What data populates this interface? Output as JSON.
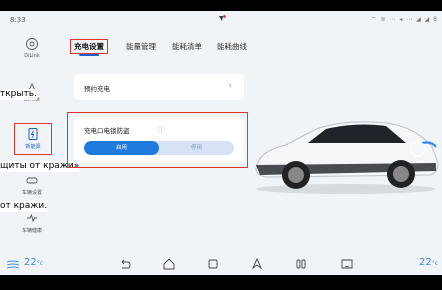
{
  "status_bar": {
    "time": "8:33",
    "right_icons": "⌔ ≋ ⋯ ◂ ⋯ ◢ ◢ 8"
  },
  "sidebar": {
    "items": [
      {
        "label": "DiLink",
        "icon": "dilink-icon"
      },
      {
        "label": "DiPilot",
        "icon": "dipilot-icon"
      },
      {
        "label": "新能源",
        "icon": "new-energy-icon",
        "active": true
      },
      {
        "label": "车辆设置",
        "icon": "vehicle-settings-icon"
      },
      {
        "label": "车辆健康",
        "icon": "vehicle-health-icon"
      }
    ]
  },
  "overlay_fragments": [
    "ткрыть.",
    "щиты от кражи»",
    "от кражи."
  ],
  "tabs": [
    {
      "label": "充电设置",
      "active": true
    },
    {
      "label": "能量管理"
    },
    {
      "label": "能耗清单"
    },
    {
      "label": "能耗曲线"
    }
  ],
  "settings": {
    "scheduled_charging": {
      "label": "预约充电",
      "chevron": "›"
    },
    "charging_lock": {
      "label": "充电口电锁防盗",
      "info_icon": "ⓘ",
      "options": [
        "启用",
        "停用"
      ],
      "selected": "启用"
    }
  },
  "dock": {
    "temp_left": "22",
    "temp_right": "22",
    "temp_unit": "°c",
    "accent_color": "#3e8ae6"
  },
  "colors": {
    "accent": "#1f7ae0",
    "highlight_border": "#e3342f",
    "background": "#f1f4f7"
  }
}
